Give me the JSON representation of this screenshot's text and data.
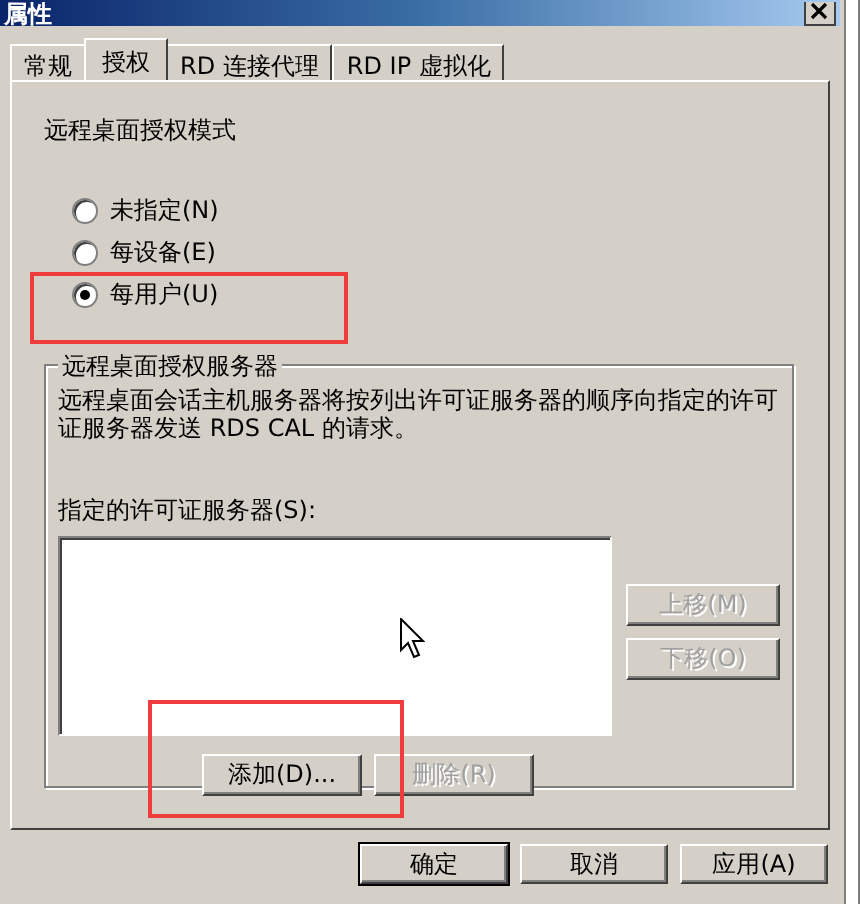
{
  "window": {
    "title": "属性"
  },
  "tabs": [
    {
      "label": "常规",
      "selected": false
    },
    {
      "label": "授权",
      "selected": true
    },
    {
      "label": "RD 连接代理",
      "selected": false
    },
    {
      "label": "RD IP 虚拟化",
      "selected": false
    }
  ],
  "mode": {
    "title": "远程桌面授权模式",
    "options": [
      {
        "label": "未指定(N)",
        "selected": false
      },
      {
        "label": "每设备(E)",
        "selected": false
      },
      {
        "label": "每用户(U)",
        "selected": true
      }
    ]
  },
  "servers": {
    "title": "远程桌面授权服务器",
    "description": "远程桌面会话主机服务器将按列出许可证服务器的顺序向指定的许可证服务器发送 RDS CAL 的请求。",
    "list_label": "指定的许可证服务器(S):",
    "side_buttons": [
      {
        "label": "上移(M)",
        "disabled": true
      },
      {
        "label": "下移(O)",
        "disabled": true
      }
    ],
    "list_buttons": [
      {
        "label": "添加(D)...",
        "disabled": false
      },
      {
        "label": "删除(R)",
        "disabled": true
      }
    ]
  },
  "buttons": [
    {
      "label": "确定",
      "default": true,
      "disabled": false
    },
    {
      "label": "取消",
      "default": false,
      "disabled": false
    },
    {
      "label": "应用(A)",
      "default": false,
      "disabled": false
    }
  ]
}
